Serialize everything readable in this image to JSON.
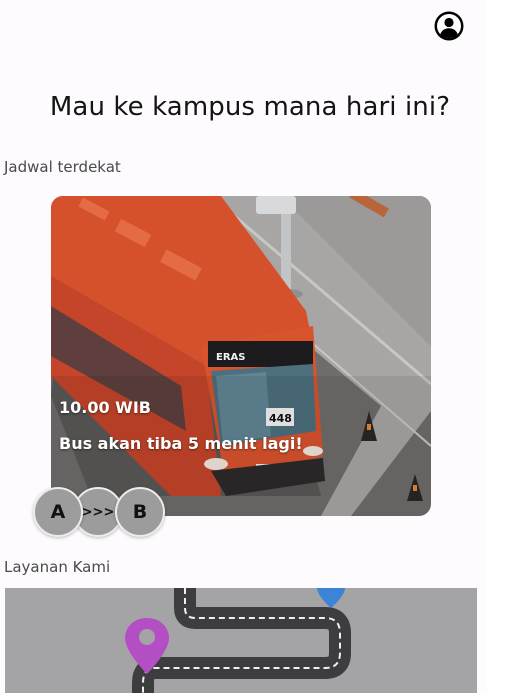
{
  "header": {
    "profile_icon": "account-circle-icon"
  },
  "headline": "Mau ke kampus mana hari ini?",
  "schedule": {
    "section_label": "Jadwal terdekat",
    "time": "10.00 WIB",
    "message": "Bus akan tiba 5 menit lagi!",
    "route": {
      "from": "A",
      "arrow": ">>>",
      "to": "B"
    },
    "bus_sign": "ERAS",
    "bus_number": "448"
  },
  "services": {
    "section_label": "Layanan Kami"
  },
  "colors": {
    "bus_red": "#d5512c",
    "road": "#6f6d6c",
    "badge_grey": "#9c9c9c",
    "pin_purple": "#b44ec4",
    "pin_blue": "#3b84d6"
  }
}
